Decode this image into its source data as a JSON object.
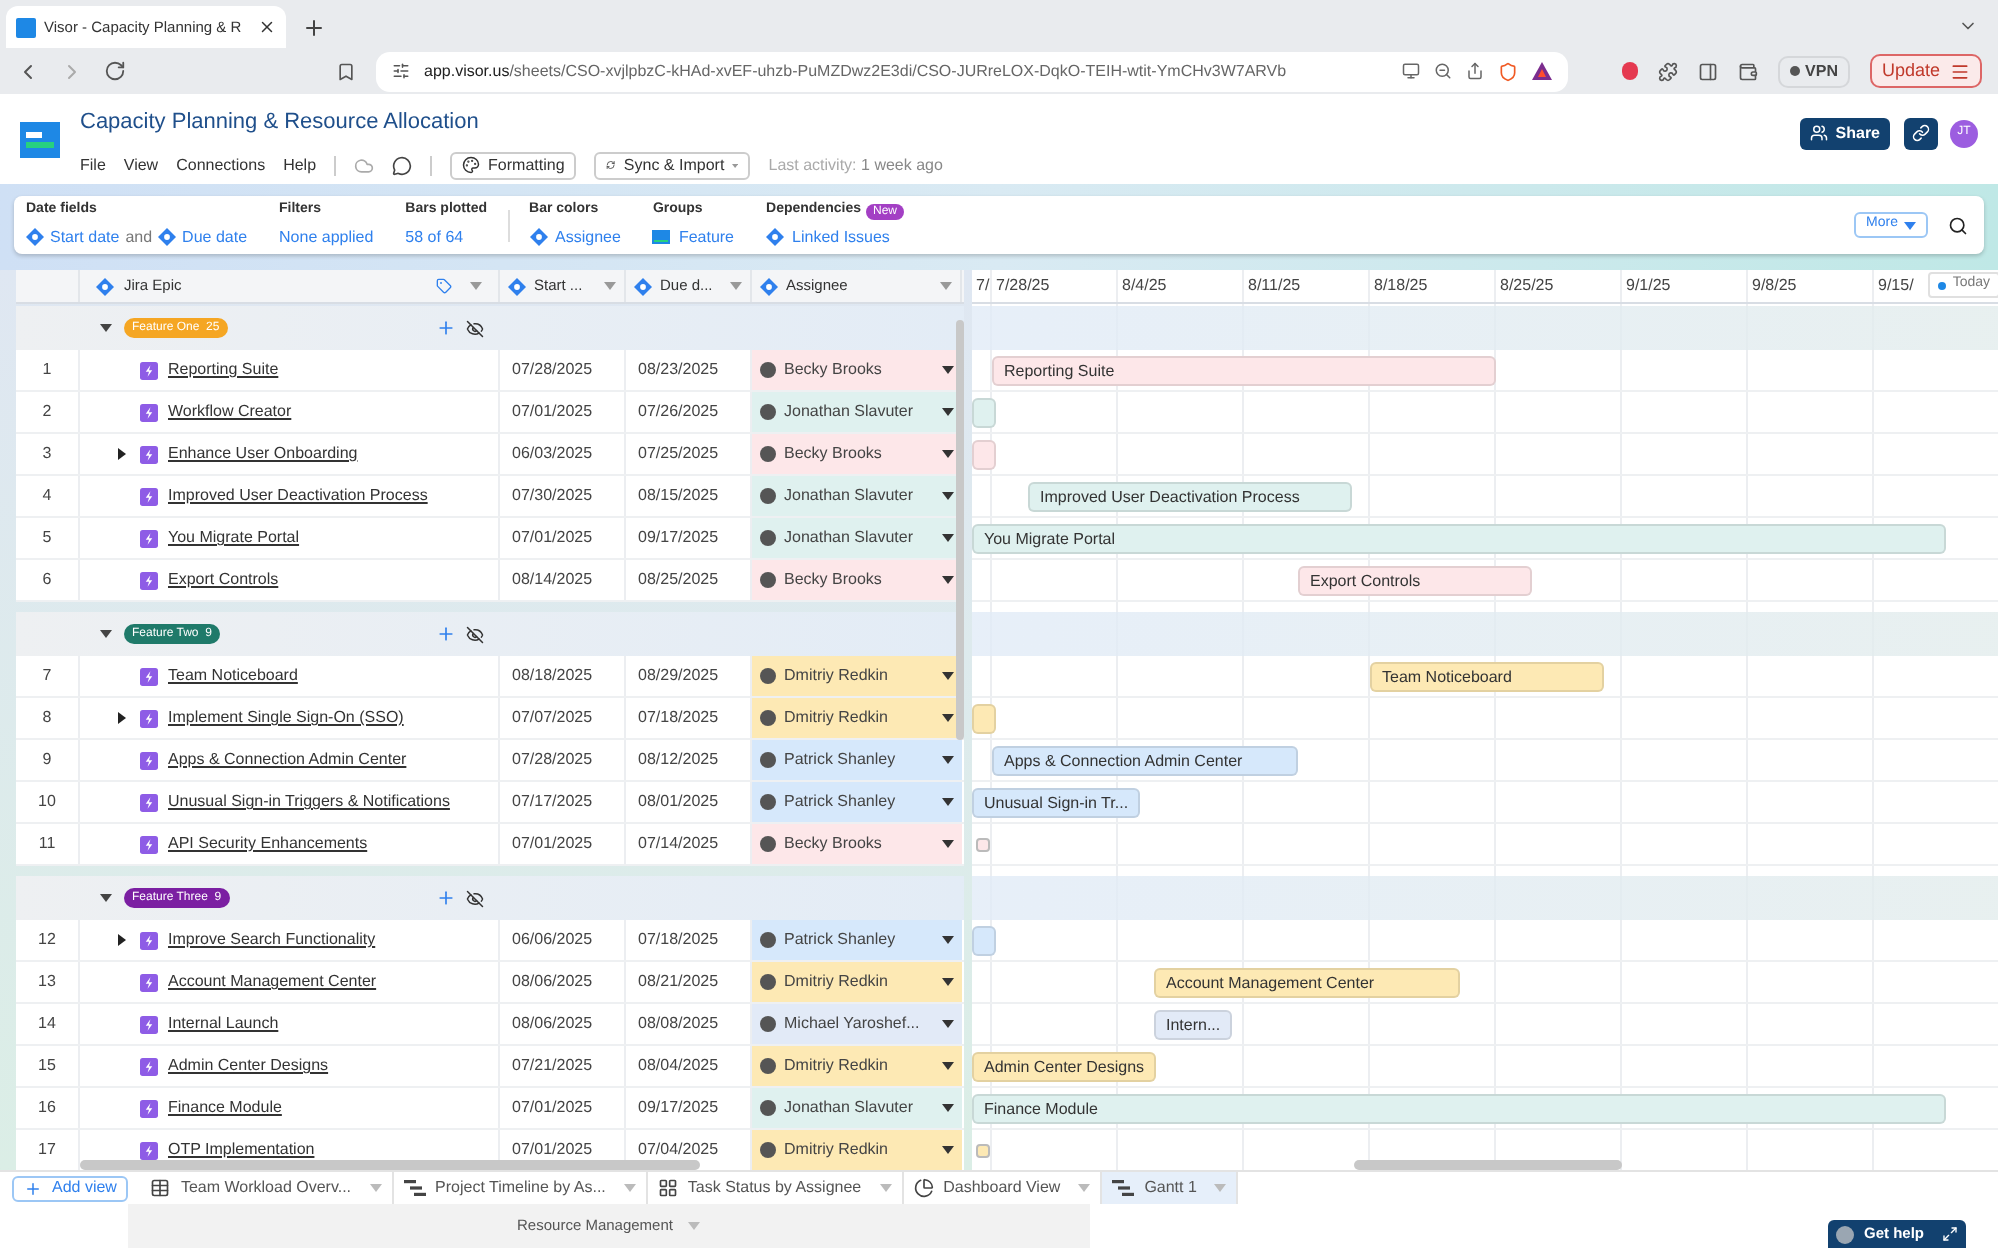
{
  "browser": {
    "tab_title": "Visor - Capacity Planning & R",
    "url_host": "app.visor.us",
    "url_path": "/sheets/CSO-xvjlpbzC-kHAd-xvEF-uhzb-PuMZDwz2E3di/CSO-JURreLOX-DqkO-TEIH-wtit-YmCHv3W7ARVb",
    "vpn": "VPN",
    "update": "Update"
  },
  "app": {
    "title": "Capacity Planning & Resource Allocation",
    "menu": [
      "File",
      "View",
      "Connections",
      "Help"
    ],
    "formatting": "Formatting",
    "sync": "Sync & Import",
    "last_activity_label": "Last activity:",
    "last_activity_value": "1 week ago",
    "share": "Share",
    "user_initials": "JT"
  },
  "toolbar": {
    "date_fields": {
      "label": "Date fields",
      "start": "Start date",
      "connector": "and",
      "due": "Due date"
    },
    "filters": {
      "label": "Filters",
      "value": "None applied"
    },
    "bars_plotted": {
      "label": "Bars plotted",
      "value": "58 of 64"
    },
    "bar_colors": {
      "label": "Bar colors",
      "value": "Assignee"
    },
    "groups": {
      "label": "Groups",
      "value": "Feature"
    },
    "dependencies": {
      "label": "Dependencies",
      "badge": "New",
      "value": "Linked Issues"
    },
    "more": "More"
  },
  "columns": [
    "Jira Epic",
    "Start ...",
    "Due d...",
    "Assignee"
  ],
  "timeline": {
    "weeks": [
      "7/",
      "7/28/25",
      "8/4/25",
      "8/11/25",
      "8/18/25",
      "8/25/25",
      "9/1/25",
      "9/8/25",
      "9/15/"
    ],
    "today": "Today"
  },
  "groups": [
    {
      "name": "Feature One",
      "count": "25",
      "color": "#f5a623",
      "expanded": true,
      "rows": [
        {
          "num": "1",
          "name": "Reporting Suite",
          "start": "07/28/2025",
          "due": "08/23/2025",
          "assignee": "Becky Brooks",
          "color": "#fde7e9",
          "expandable": false,
          "bar_label": "Reporting Suite"
        },
        {
          "num": "2",
          "name": "Workflow Creator",
          "start": "07/01/2025",
          "due": "07/26/2025",
          "assignee": "Jonathan Slavuter",
          "color": "#dff1ef",
          "expandable": false
        },
        {
          "num": "3",
          "name": "Enhance User Onboarding",
          "start": "06/03/2025",
          "due": "07/25/2025",
          "assignee": "Becky Brooks",
          "color": "#fde7e9",
          "expandable": true
        },
        {
          "num": "4",
          "name": "Improved User Deactivation Process",
          "start": "07/30/2025",
          "due": "08/15/2025",
          "assignee": "Jonathan Slavuter",
          "color": "#dff1ef",
          "expandable": false,
          "bar_label": "Improved User Deactivation Process"
        },
        {
          "num": "5",
          "name": "You Migrate Portal",
          "start": "07/01/2025",
          "due": "09/17/2025",
          "assignee": "Jonathan Slavuter",
          "color": "#dff1ef",
          "expandable": false,
          "bar_label": "You Migrate Portal"
        },
        {
          "num": "6",
          "name": "Export Controls",
          "start": "08/14/2025",
          "due": "08/25/2025",
          "assignee": "Becky Brooks",
          "color": "#fde7e9",
          "expandable": false,
          "bar_label": "Export Controls"
        }
      ]
    },
    {
      "name": "Feature Two",
      "count": "9",
      "color": "#1f7a6a",
      "expanded": true,
      "rows": [
        {
          "num": "7",
          "name": "Team Noticeboard",
          "start": "08/18/2025",
          "due": "08/29/2025",
          "assignee": "Dmitriy Redkin",
          "color": "#fde9b4",
          "expandable": false,
          "bar_label": "Team Noticeboard"
        },
        {
          "num": "8",
          "name": "Implement Single Sign-On (SSO)",
          "start": "07/07/2025",
          "due": "07/18/2025",
          "assignee": "Dmitriy Redkin",
          "color": "#fde9b4",
          "expandable": true
        },
        {
          "num": "9",
          "name": "Apps & Connection Admin Center",
          "start": "07/28/2025",
          "due": "08/12/2025",
          "assignee": "Patrick Shanley",
          "color": "#d6e8fb",
          "expandable": false,
          "bar_label": "Apps & Connection Admin Center"
        },
        {
          "num": "10",
          "name": "Unusual Sign-in Triggers & Notifications",
          "start": "07/17/2025",
          "due": "08/01/2025",
          "assignee": "Patrick Shanley",
          "color": "#d6e8fb",
          "expandable": false,
          "bar_label": "Unusual Sign-in Tr..."
        },
        {
          "num": "11",
          "name": "API Security Enhancements",
          "start": "07/01/2025",
          "due": "07/14/2025",
          "assignee": "Becky Brooks",
          "color": "#fde7e9",
          "expandable": false
        }
      ]
    },
    {
      "name": "Feature Three",
      "count": "9",
      "color": "#7b1fa2",
      "expanded": true,
      "rows": [
        {
          "num": "12",
          "name": "Improve Search Functionality",
          "start": "06/06/2025",
          "due": "07/18/2025",
          "assignee": "Patrick Shanley",
          "color": "#d6e8fb",
          "expandable": true
        },
        {
          "num": "13",
          "name": "Account Management Center",
          "start": "08/06/2025",
          "due": "08/21/2025",
          "assignee": "Dmitriy Redkin",
          "color": "#fde9b4",
          "expandable": false,
          "bar_label": "Account Management Center"
        },
        {
          "num": "14",
          "name": "Internal Launch",
          "start": "08/06/2025",
          "due": "08/08/2025",
          "assignee": "Michael Yaroshef...",
          "color": "#e2eaf7",
          "expandable": false,
          "bar_label": "Intern..."
        },
        {
          "num": "15",
          "name": "Admin Center Designs",
          "start": "07/21/2025",
          "due": "08/04/2025",
          "assignee": "Dmitriy Redkin",
          "color": "#fde9b4",
          "expandable": false,
          "bar_label": "Admin Center Designs"
        },
        {
          "num": "16",
          "name": "Finance Module",
          "start": "07/01/2025",
          "due": "09/17/2025",
          "assignee": "Jonathan Slavuter",
          "color": "#dff1ef",
          "expandable": false,
          "bar_label": "Finance Module"
        },
        {
          "num": "17",
          "name": "OTP Implementation",
          "start": "07/01/2025",
          "due": "07/04/2025",
          "assignee": "Dmitriy Redkin",
          "color": "#fde9b4",
          "expandable": false
        }
      ]
    }
  ],
  "footer": {
    "add_view": "Add view",
    "views": [
      {
        "label": "Team Workload Overv...",
        "kind": "table",
        "selected": false
      },
      {
        "label": "Project Timeline by As...",
        "kind": "gantt",
        "selected": false
      },
      {
        "label": "Task Status by Assignee",
        "kind": "board",
        "selected": false
      },
      {
        "label": "Dashboard View",
        "kind": "pie",
        "selected": false
      },
      {
        "label": "Gantt 1",
        "kind": "gantt",
        "selected": true
      }
    ],
    "workspace": "Resource Management",
    "get_help": "Get help"
  }
}
